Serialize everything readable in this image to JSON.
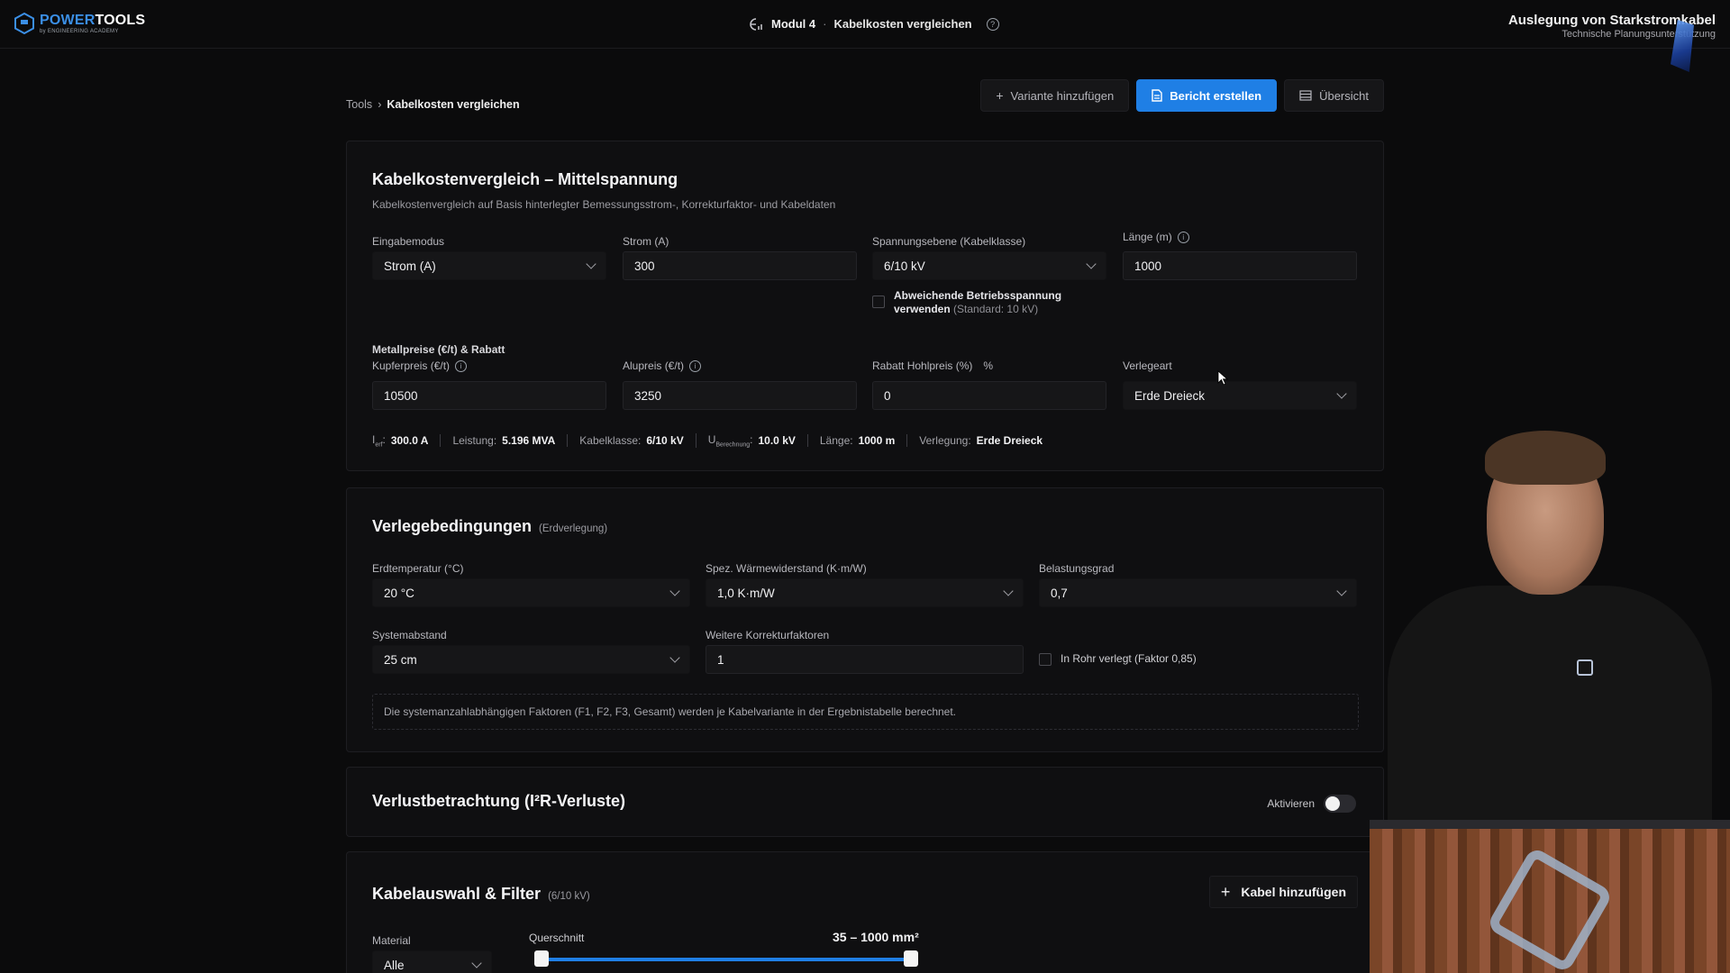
{
  "header": {
    "logo_main_a": "POWER",
    "logo_main_b": "TOOLS",
    "logo_sub": "by ENGINEERING ACADEMY",
    "module_label": "Modul 4",
    "module_sep": "·",
    "module_title": "Kabelkosten vergleichen",
    "help_glyph": "?",
    "course_title": "Auslegung von Starkstromkabel",
    "course_subtitle": "Technische Planungsunterstützung"
  },
  "breadcrumb": {
    "root": "Tools",
    "separator": "›",
    "current": "Kabelkosten vergleichen"
  },
  "actions": {
    "add_variant": "Variante hinzufügen",
    "create_report": "Bericht erstellen",
    "overview": "Übersicht"
  },
  "comparison": {
    "title": "Kabelkostenvergleich – Mittelspannung",
    "subtitle": "Kabelkostenvergleich auf Basis hinterlegter Bemessungsstrom-, Korrekturfaktor- und Kabeldaten",
    "input_mode_label": "Eingabemodus",
    "input_mode_value": "Strom (A)",
    "current_label": "Strom (A)",
    "current_value": "300",
    "voltage_label": "Spannungsebene (Kabelklasse)",
    "voltage_value": "6/10 kV",
    "length_label": "Länge (m)",
    "length_value": "1000",
    "deviating_voltage_label": "Abweichende Betriebsspannung verwenden",
    "deviating_voltage_hint": "(Standard: 10 kV)",
    "metal_prices_heading": "Metallpreise (€/t) & Rabatt",
    "copper_label": "Kupferpreis (€/t)",
    "copper_value": "10500",
    "aluminium_label": "Alupreis (€/t)",
    "aluminium_value": "3250",
    "discount_label": "Rabatt Hohlpreis (%)",
    "discount_unit": "%",
    "discount_value": "0",
    "laying_label": "Verlegeart",
    "laying_value": "Erde Dreieck"
  },
  "summary": {
    "i_symbol": "I",
    "i_sub": "erf",
    "i_value": "300.0 A",
    "power_label": "Leistung:",
    "power_value": "5.196 MVA",
    "class_label": "Kabelklasse:",
    "class_value": "6/10 kV",
    "u_symbol": "U",
    "u_sub": "Berechnung",
    "u_value": "10.0 kV",
    "length_label": "Länge:",
    "length_value": "1000 m",
    "laying_label": "Verlegung:",
    "laying_value": "Erde Dreieck"
  },
  "laying_conditions": {
    "title": "Verlegebedingungen",
    "aside": "(Erdverlegung)",
    "soil_temp_label": "Erdtemperatur (°C)",
    "soil_temp_value": "20 °C",
    "thermal_res_label": "Spez. Wärmewiderstand (K·m/W)",
    "thermal_res_value": "1,0 K·m/W",
    "load_factor_label": "Belastungsgrad",
    "load_factor_value": "0,7",
    "spacing_label": "Systemabstand",
    "spacing_value": "25 cm",
    "more_factors_label": "Weitere Korrekturfaktoren",
    "more_factors_value": "1",
    "in_pipe_label": "In Rohr verlegt (Faktor 0,85)",
    "note": "Die systemanzahlabhängigen Faktoren (F1, F2, F3, Gesamt) werden je Kabelvariante in der Ergebnistabelle berechnet."
  },
  "losses": {
    "title": "Verlustbetrachtung (I²R-Verluste)",
    "toggle_label": "Aktivieren",
    "enabled": false
  },
  "selection": {
    "title": "Kabelauswahl & Filter",
    "aside": "(6/10 kV)",
    "add_cable": "Kabel hinzufügen",
    "material_label": "Material",
    "material_value": "Alle",
    "cross_section_label": "Querschnitt",
    "cross_section_range": "35 – 1000 mm²",
    "range_min_fraction": 0.0,
    "range_max_fraction": 1.0
  },
  "colors": {
    "accent": "#1f7fe5",
    "background": "#0b0b0c",
    "card": "#0f0f11"
  },
  "icons": [
    "logo-icon",
    "module-icon",
    "help-icon",
    "plus-icon",
    "document-icon",
    "list-icon",
    "info-icon",
    "chevron-down-icon",
    "percent-icon",
    "cursor-icon"
  ]
}
